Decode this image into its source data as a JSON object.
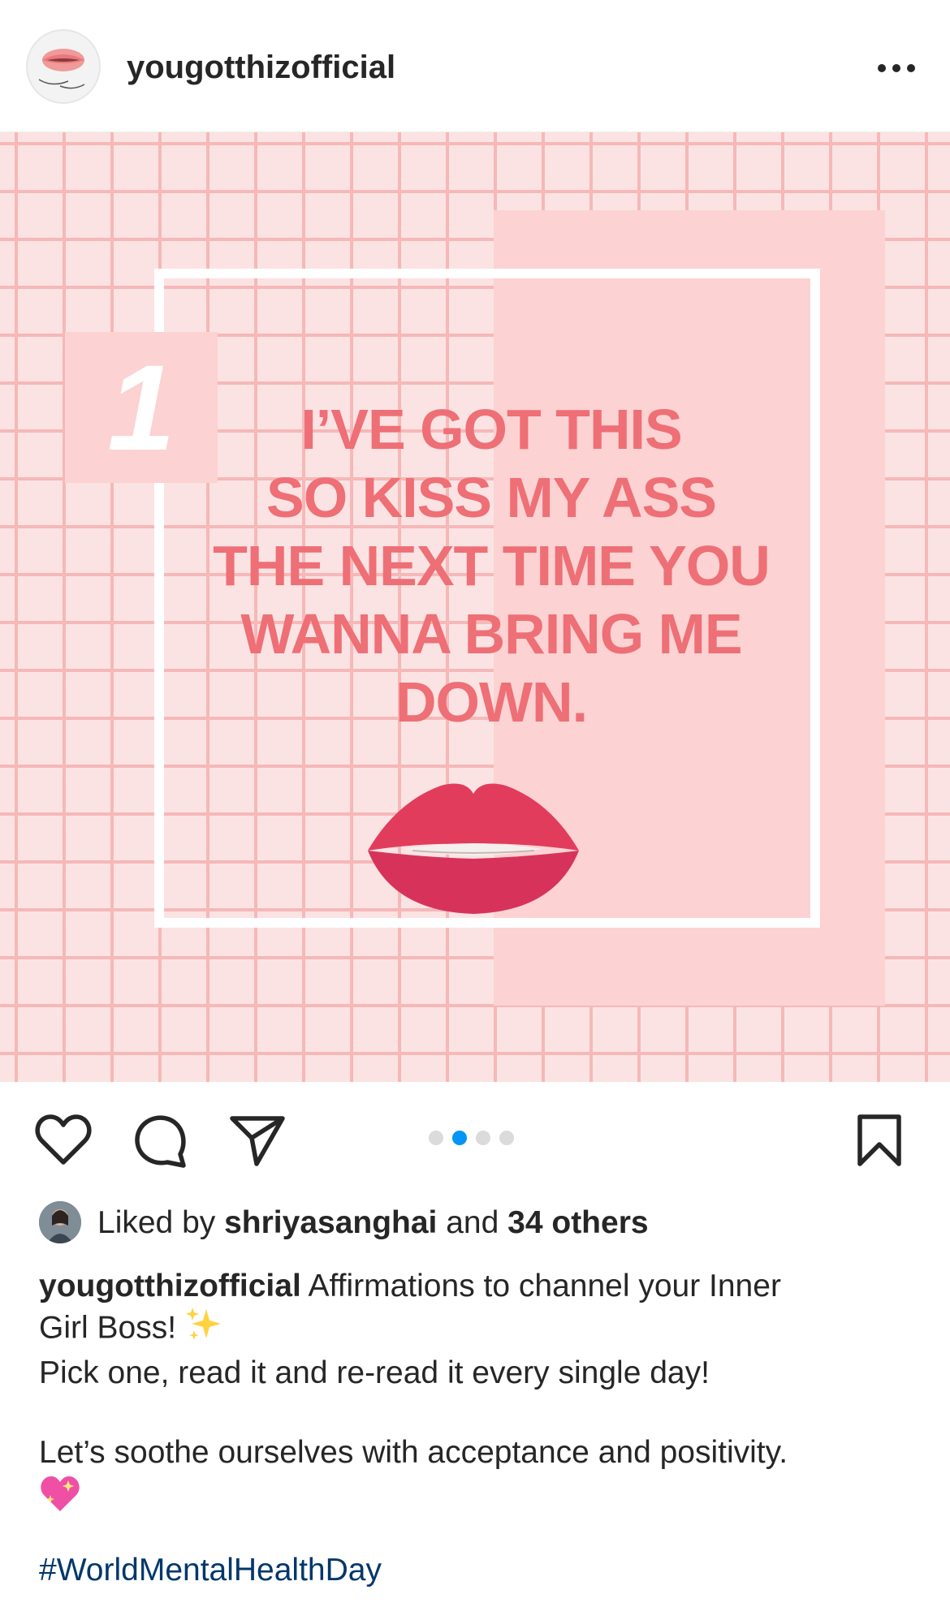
{
  "post": {
    "username": "yougotthizofficial",
    "slide_number": "1",
    "quote_lines": [
      "I’VE GOT THIS",
      "SO KISS MY ASS",
      "THE NEXT TIME YOU",
      "WANNA BRING ME",
      "DOWN."
    ]
  },
  "carousel": {
    "total": 4,
    "active_index": 1
  },
  "likes": {
    "prefix": "Liked by",
    "user": "shriyasanghai",
    "and": "and",
    "others": "34 others"
  },
  "caption": {
    "username": "yougotthizofficial",
    "line1": "Affirmations to channel your Inner",
    "line2": "Girl Boss!",
    "line3": "Pick one, read it and re-read it every single day!",
    "line4": "Let’s soothe ourselves with acceptance and positivity.",
    "hashtag": "#WorldMentalHealthDay"
  },
  "colors": {
    "accent": "#0095f6",
    "quote_pink": "#ee6f76",
    "block_pink": "#fcd2d2",
    "hashtag_blue": "#00376b"
  },
  "icons": [
    "heart-icon",
    "comment-icon",
    "share-icon",
    "bookmark-icon",
    "more-icon",
    "sparkles-icon",
    "heart-sparkle-icon"
  ]
}
